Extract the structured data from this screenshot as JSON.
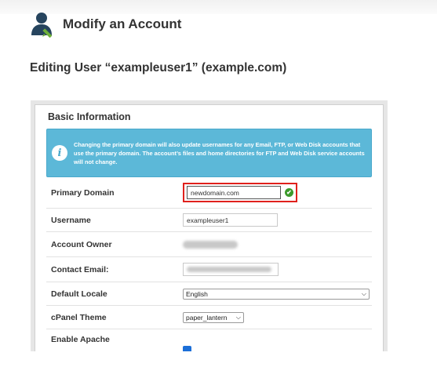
{
  "header": {
    "title": "Modify an Account",
    "icon": "user-edit-icon"
  },
  "editing": {
    "title": "Editing User “exampleuser1” (example.com)"
  },
  "panel": {
    "title": "Basic Information",
    "alert": {
      "icon": "info-icon",
      "glyph": "i",
      "text": "Changing the primary domain will also update usernames for any Email, FTP, or Web Disk accounts that use the primary domain. The account’s files and home directories for FTP and Web Disk service accounts will not change."
    },
    "fields": {
      "primary_domain": {
        "label": "Primary Domain",
        "value": "newdomain.com",
        "status_icon": "checkmark-valid-icon",
        "status_glyph": "✔"
      },
      "username": {
        "label": "Username",
        "value": "exampleuser1"
      },
      "account_owner": {
        "label": "Account Owner"
      },
      "contact_email": {
        "label": "Contact Email:"
      },
      "default_locale": {
        "label": "Default Locale",
        "value": "English"
      },
      "cpanel_theme": {
        "label": "cPanel Theme",
        "value": "paper_lantern"
      },
      "enable_apache": {
        "label": "Enable Apache"
      }
    }
  },
  "colors": {
    "highlight": "#e0211c",
    "alert_bg": "#5cb8d8",
    "valid": "#3c9a2c",
    "checkbox": "#1c6fd8"
  }
}
